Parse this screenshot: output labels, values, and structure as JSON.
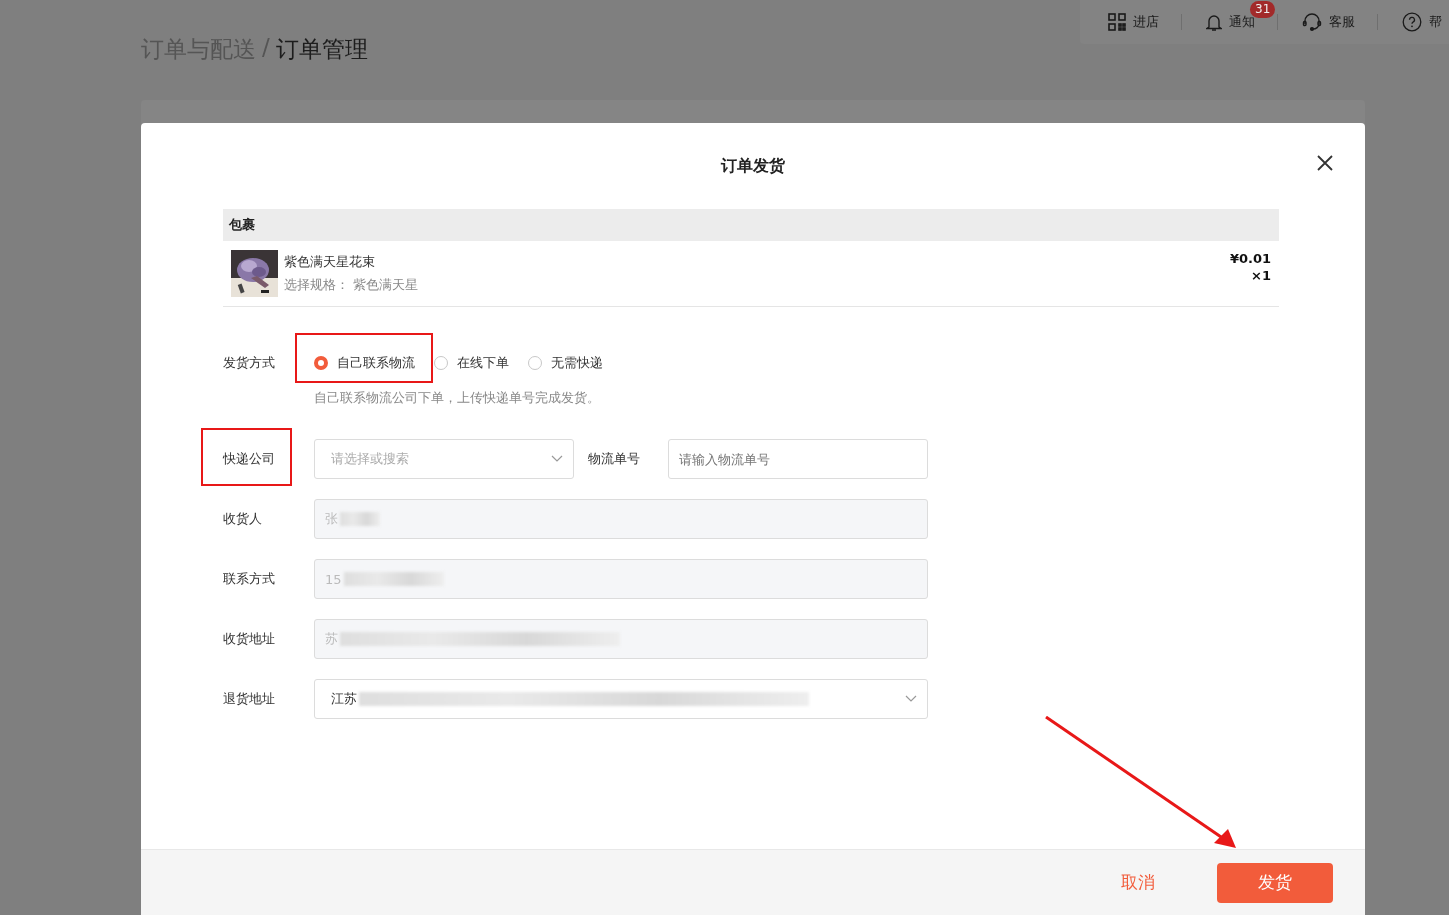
{
  "header": {
    "breadcrumb": [
      {
        "label": "订单与配送",
        "selected": false
      },
      {
        "label": "订单管理",
        "selected": true
      }
    ],
    "separator": "/",
    "toolbar": [
      {
        "label": "进店"
      },
      {
        "label": "通知",
        "badge": "31"
      },
      {
        "label": "客服"
      },
      {
        "label": "帮"
      }
    ]
  },
  "dialog": {
    "title": "订单发货",
    "package": {
      "heading": "包裹",
      "items": [
        {
          "name": "紫色满天星花束",
          "spec": "选择规格：  紫色满天星",
          "price": "¥0.01",
          "quantity": "×1"
        }
      ]
    },
    "method": {
      "label": "发货方式",
      "options": [
        {
          "label": "自己联系物流",
          "selected": true,
          "highlighted": true
        },
        {
          "label": "在线下单",
          "selected": false,
          "highlighted": false
        },
        {
          "label": "无需快递",
          "selected": false,
          "highlighted": false
        }
      ],
      "hint": "自己联系物流公司下单，上传快递单号完成发货。"
    },
    "courier": {
      "label": "快递公司",
      "placeholder": "请选择或搜索",
      "highlighted": true
    },
    "tracking": {
      "label": "物流单号",
      "placeholder": "请输入物流单号"
    },
    "fields": [
      {
        "kind": "readonly",
        "label": "收货人",
        "value": "张",
        "blurred": true
      },
      {
        "kind": "readonly",
        "label": "联系方式",
        "value": "15",
        "blurred": true
      },
      {
        "kind": "readonly",
        "label": "收货地址",
        "value": "苏",
        "blurred": true
      },
      {
        "kind": "select",
        "label": "退货地址",
        "value": "江苏",
        "blurred": true
      }
    ],
    "buttons": [
      {
        "label": "取消",
        "kind": "text"
      },
      {
        "label": "发货",
        "kind": "primary"
      }
    ]
  }
}
